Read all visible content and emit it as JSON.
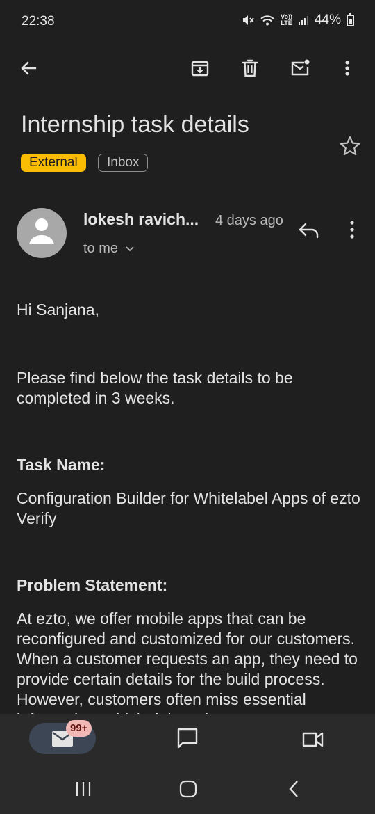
{
  "status": {
    "time": "22:38",
    "volte_top": "Vo))",
    "volte_bottom": "LTE",
    "battery": "44%"
  },
  "toolbar": {
    "back": "back-arrow-icon",
    "archive": "archive-icon",
    "delete": "trash-icon",
    "mark_unread": "mark-unread-icon",
    "more": "more-vert-icon"
  },
  "email": {
    "subject": "Internship task details",
    "labels": [
      "External",
      "Inbox"
    ],
    "sender": "lokesh ravich...",
    "time": "4 days ago",
    "recipient": "to me",
    "greeting": "Hi Sanjana,",
    "intro": "Please find below the task details to be completed in 3 weeks.",
    "task_heading": "Task Name:",
    "task_name": "Configuration Builder for Whitelabel Apps of ezto Verify",
    "problem_heading": "Problem Statement:",
    "problem_text": "At ezto, we offer mobile apps that can be reconfigured and customized for our customers. When a customer requests an app, they need to provide certain details for the build process. However, customers often miss essential information, which delays the"
  },
  "bottom_nav": {
    "mail_badge": "99+"
  },
  "colors": {
    "background": "#1f1f1f",
    "external_chip": "#fbbc04",
    "mail_pill": "#3c4654",
    "badge": "#f2b8b5"
  }
}
